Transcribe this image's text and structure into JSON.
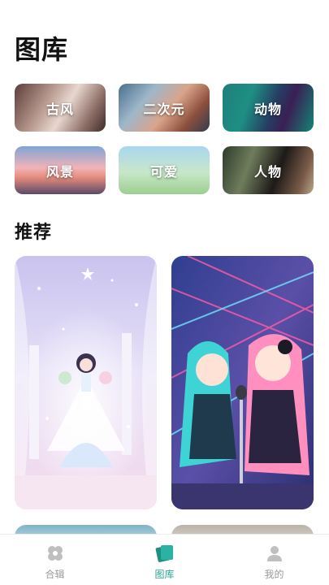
{
  "header": {
    "title": "图库"
  },
  "categories": [
    {
      "label": "古风",
      "icon": "category-ancient-style-image"
    },
    {
      "label": "二次元",
      "icon": "category-anime-image"
    },
    {
      "label": "动物",
      "icon": "category-animal-image"
    },
    {
      "label": "风景",
      "icon": "category-scenery-image"
    },
    {
      "label": "可爱",
      "icon": "category-cute-image"
    },
    {
      "label": "人物",
      "icon": "category-portrait-image"
    }
  ],
  "recommend": {
    "title": "推荐"
  },
  "tabbar": {
    "items": [
      {
        "label": "合辑",
        "icon": "collection-icon",
        "active": false
      },
      {
        "label": "图库",
        "icon": "gallery-icon",
        "active": true
      },
      {
        "label": "我的",
        "icon": "profile-icon",
        "active": false
      }
    ],
    "active_color": "#2aa596",
    "inactive_color": "#9a9a9a"
  }
}
